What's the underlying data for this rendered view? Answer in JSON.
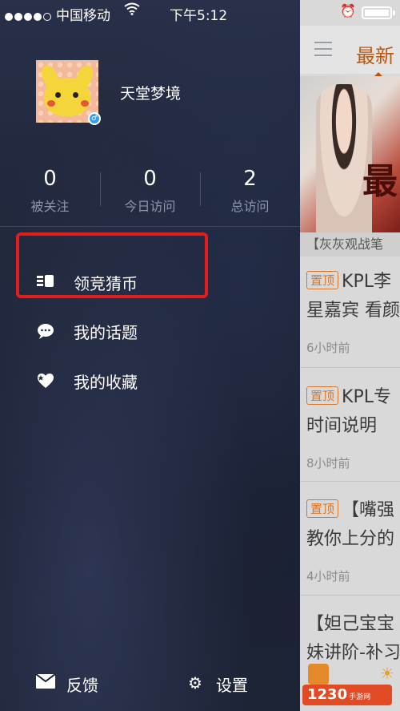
{
  "status_bar": {
    "carrier": "中国移动",
    "wifi_icon": "wifi-icon",
    "time": "下午5:12",
    "alarm_icon": "alarm-icon",
    "battery_icon": "battery-icon"
  },
  "profile": {
    "username": "天堂梦境",
    "avatar": "avatar",
    "badge_icon": "gender-badge-icon"
  },
  "stats": [
    {
      "value": "0",
      "label": "被关注"
    },
    {
      "value": "0",
      "label": "今日访问"
    },
    {
      "value": "2",
      "label": "总访问"
    }
  ],
  "menu": [
    {
      "label": "领竞猜币",
      "icon": "coins-icon"
    },
    {
      "label": "我的话题",
      "icon": "chat-bubble-icon"
    },
    {
      "label": "我的收藏",
      "icon": "favorite-icon"
    }
  ],
  "footer": {
    "feedback_label": "反馈",
    "feedback_icon": "mail-icon",
    "settings_label": "设置",
    "settings_icon": "gear-icon"
  },
  "background_feed": {
    "tab_label": "最新",
    "banner_text": "最",
    "banner_caption": "【灰灰观战笔",
    "items": [
      {
        "pin": "置顶",
        "title": "KPL李",
        "line2": "星嘉宾 看颜",
        "ago": "6小时前"
      },
      {
        "pin": "置顶",
        "title": "KPL专",
        "line2": "时间说明",
        "ago": "8小时前"
      },
      {
        "pin": "置顶",
        "title": "【嘴强",
        "line2": "教你上分的",
        "ago": "4小时前"
      },
      {
        "pin": "",
        "title": "【妲己宝宝",
        "line2": "妹讲阶-补习",
        "ago": ""
      }
    ]
  },
  "watermark": {
    "text": "1230",
    "suffix": "手游网"
  },
  "colors": {
    "highlight": "#e31c1c",
    "accent": "#c0560c",
    "pin": "#d8772a"
  }
}
